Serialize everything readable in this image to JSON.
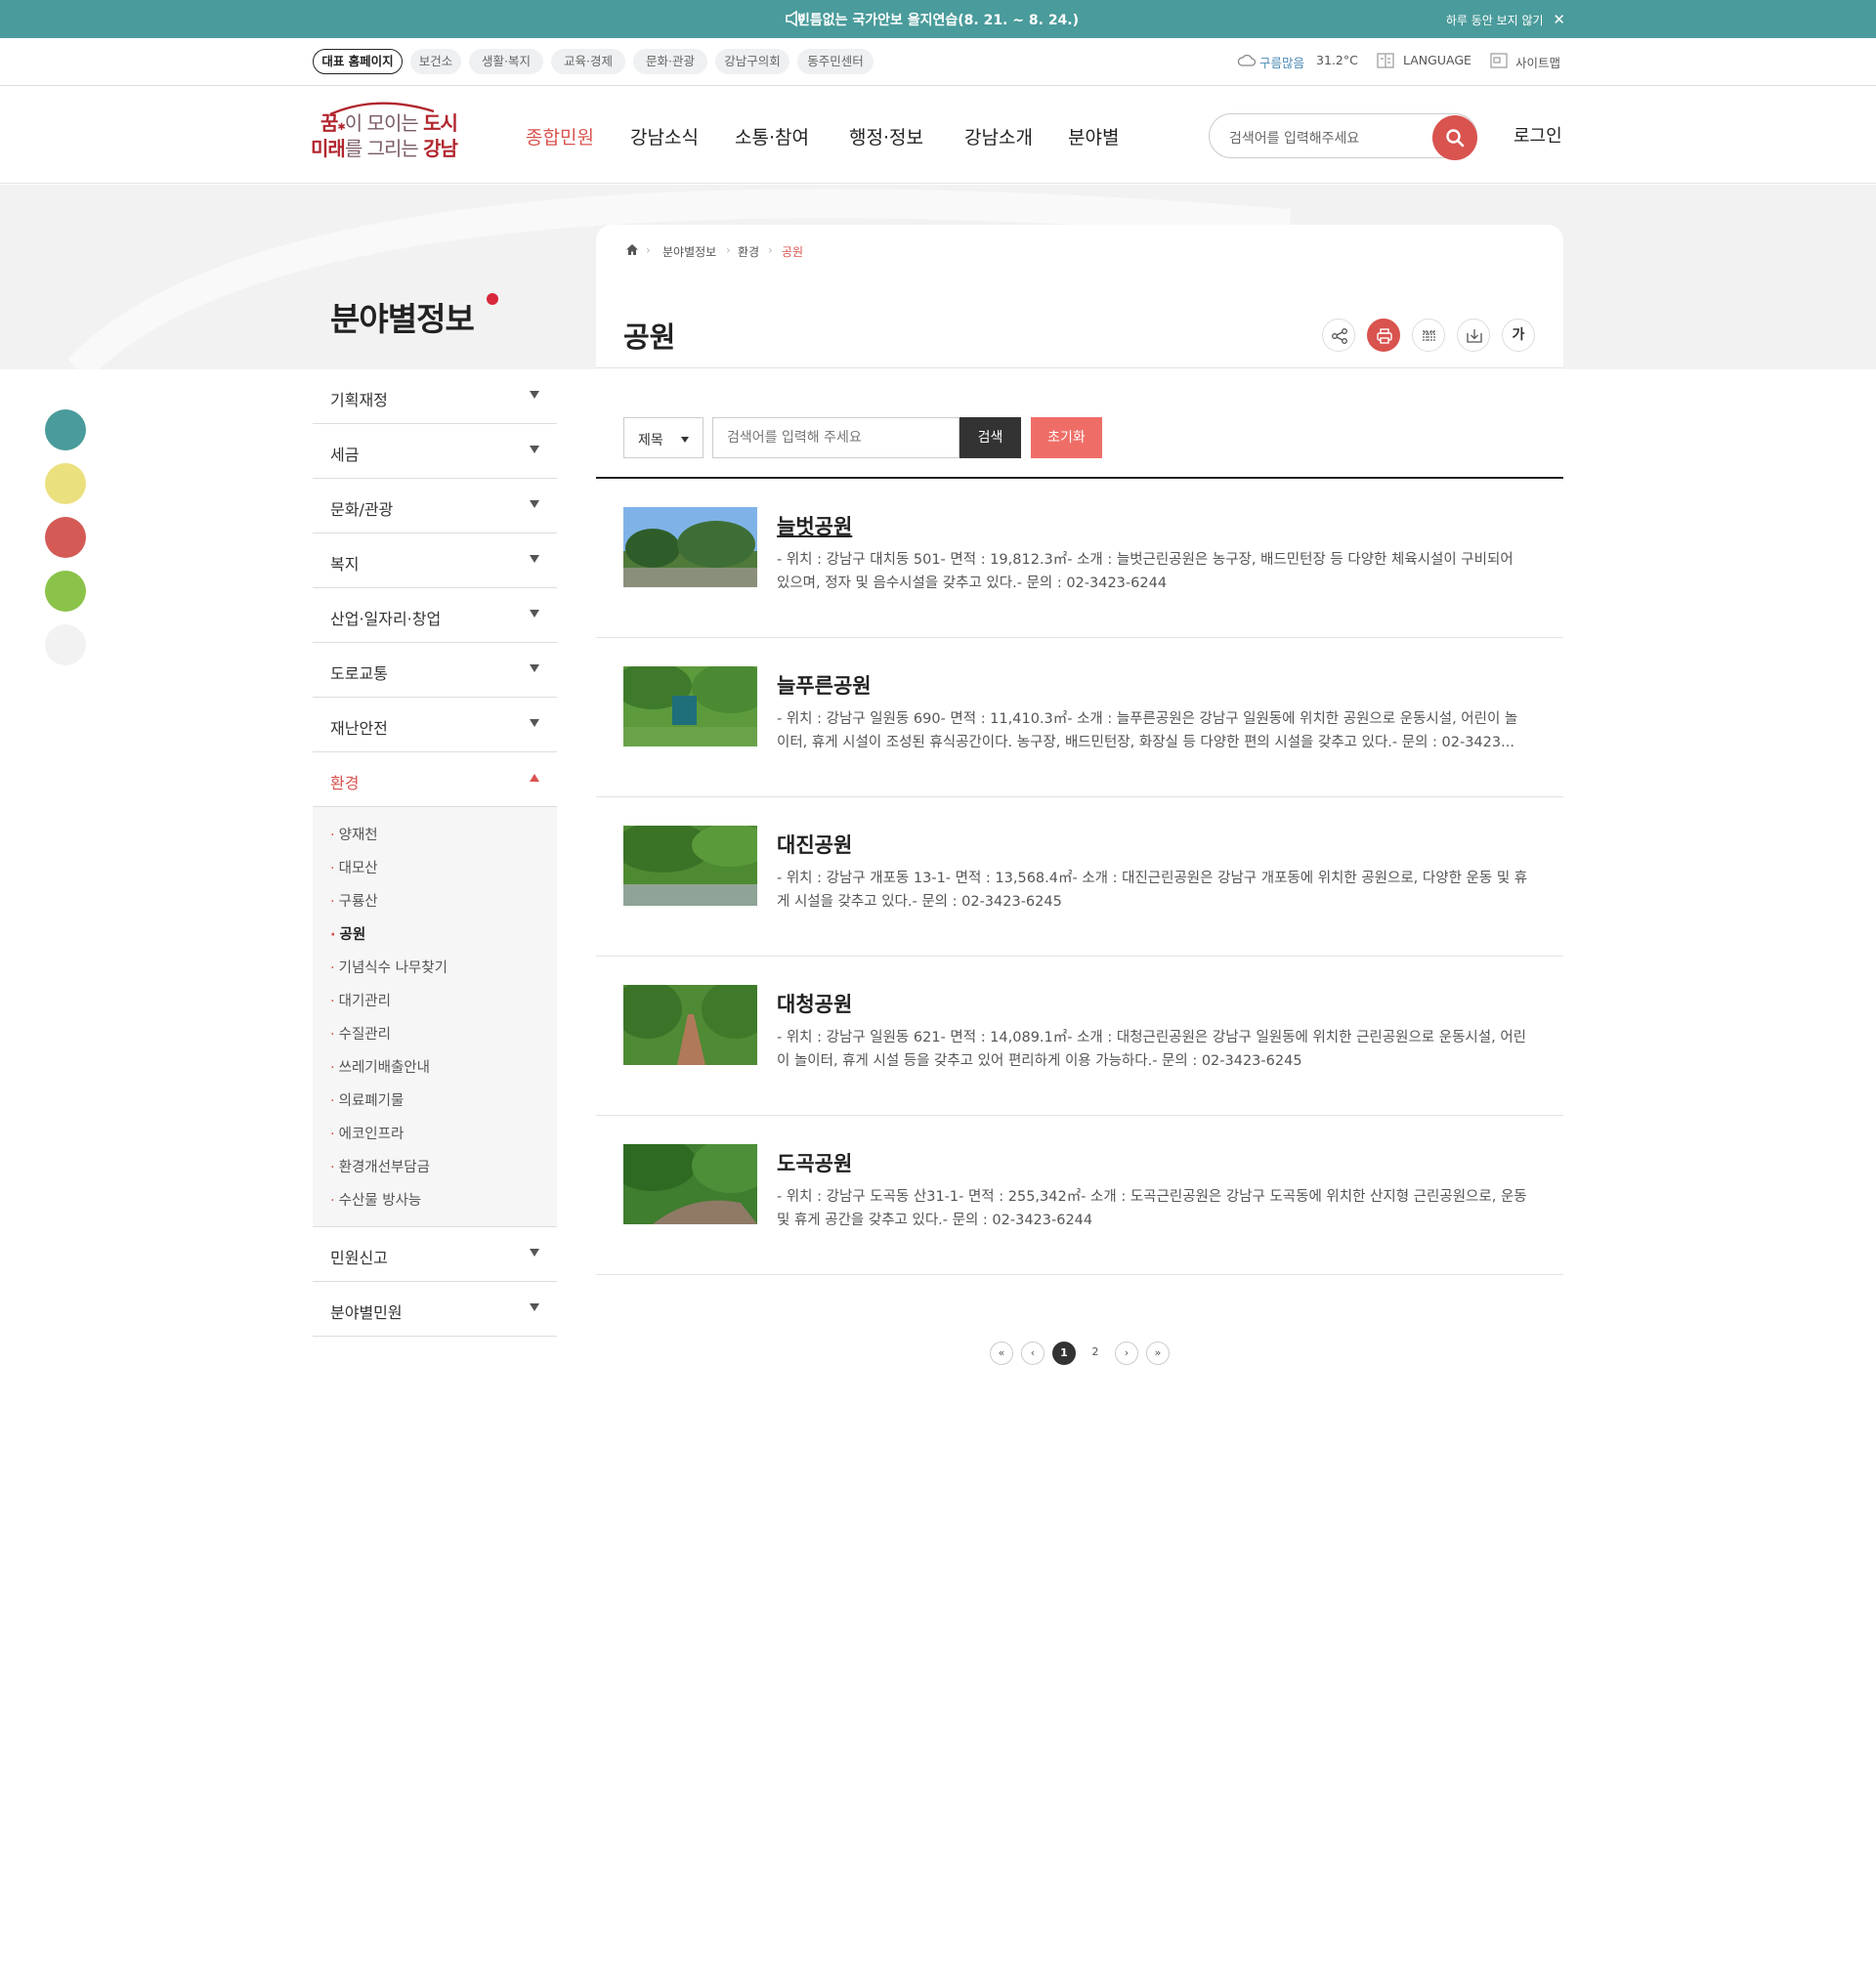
{
  "notice": {
    "text": "빈틈없는 국가안보 을지연습(8. 21. ~ 8. 24.)",
    "close_label": "하루 동안 보지 않기"
  },
  "util_links": [
    "대표 홈페이지",
    "보건소",
    "생활·복지",
    "교육·경제",
    "문화·관광",
    "강남구의회",
    "동주민센터"
  ],
  "weather": {
    "condition": "구름많음",
    "temp": "31.2°C"
  },
  "language_label": "LANGUAGE",
  "sitemap_label": "사이트맵",
  "logo": {
    "line1_a": "꿈",
    "line1_b": "이 모이는 ",
    "line1_c": "도시",
    "line2_a": "미래",
    "line2_b": "를 그리는 ",
    "line2_c": "강남"
  },
  "gnb": [
    "종합민원",
    "강남소식",
    "소통·참여",
    "행정·정보",
    "강남소개",
    "분야별"
  ],
  "header_search_placeholder": "검색어를 입력해주세요",
  "login_label": "로그인",
  "side_title": "분야별정보",
  "breadcrumb": [
    "분야별정보",
    "환경",
    "공원"
  ],
  "page_title": "공원",
  "toolbar": {
    "font_label": "가"
  },
  "lnb": {
    "items": [
      "기획재정",
      "세금",
      "문화/관광",
      "복지",
      "산업·일자리·창업",
      "도로교통",
      "재난안전",
      "환경"
    ],
    "sub_items": [
      "양재천",
      "대모산",
      "구룡산",
      "공원",
      "기념식수 나무찾기",
      "대기관리",
      "수질관리",
      "쓰레기배출안내",
      "의료폐기물",
      "에코인프라",
      "환경개선부담금",
      "수산물 방사능"
    ],
    "bottom_items": [
      "민원신고",
      "분야별민원"
    ]
  },
  "search_form": {
    "select_value": "제목",
    "placeholder": "검색어를 입력해 주세요",
    "search_label": "검색",
    "reset_label": "초기화"
  },
  "list": [
    {
      "title": "늘벗공원",
      "desc": "- 위치 : 강남구 대치동 501- 면적 : 19,812.3㎡- 소개 : 늘벗근린공원은 농구장, 배드민턴장 등 다양한 체육시설이 구비되어 있으며, 정자 및 음수시설을 갖추고 있다.- 문의 : 02-3423-6244"
    },
    {
      "title": "늘푸른공원",
      "desc": "- 위치 : 강남구 일원동 690- 면적 : 11,410.3㎡- 소개 : 늘푸른공원은 강남구 일원동에 위치한 공원으로 운동시설, 어린이 놀이터, 휴게 시설이 조성된 휴식공간이다. 농구장, 배드민턴장, 화장실 등 다양한 편의 시설을 갖추고 있다.- 문의 : 02-3423..."
    },
    {
      "title": "대진공원",
      "desc": "- 위치 : 강남구 개포동 13-1- 면적 : 13,568.4㎡- 소개 : 대진근린공원은 강남구 개포동에 위치한 공원으로, 다양한 운동 및 휴게 시설을 갖추고 있다.- 문의 : 02-3423-6245"
    },
    {
      "title": "대청공원",
      "desc": "- 위치 : 강남구 일원동 621- 면적 : 14,089.1㎡- 소개 : 대청근린공원은 강남구 일원동에 위치한 근린공원으로 운동시설, 어린이 놀이터, 휴게 시설 등을 갖추고 있어 편리하게 이용 가능하다.- 문의 : 02-3423-6245"
    },
    {
      "title": "도곡공원",
      "desc": "- 위치 : 강남구 도곡동 산31-1- 면적 : 255,342㎡- 소개 : 도곡근린공원은 강남구 도곡동에 위치한 산지형 근린공원으로, 운동 및 휴게 공간을 갖추고 있다.- 문의 : 02-3423-6244"
    }
  ],
  "pagination": {
    "first": "«",
    "prev": "‹",
    "pages": [
      "1",
      "2"
    ],
    "current": "1",
    "next": "›",
    "last": "»"
  },
  "colors": {
    "notice_bg": "#4a9b9b",
    "accent": "#d9534f",
    "side_dots": [
      "#4a9b9b",
      "#ebe07e",
      "#d45a55",
      "#8bc34a",
      "#eeeeee"
    ]
  }
}
